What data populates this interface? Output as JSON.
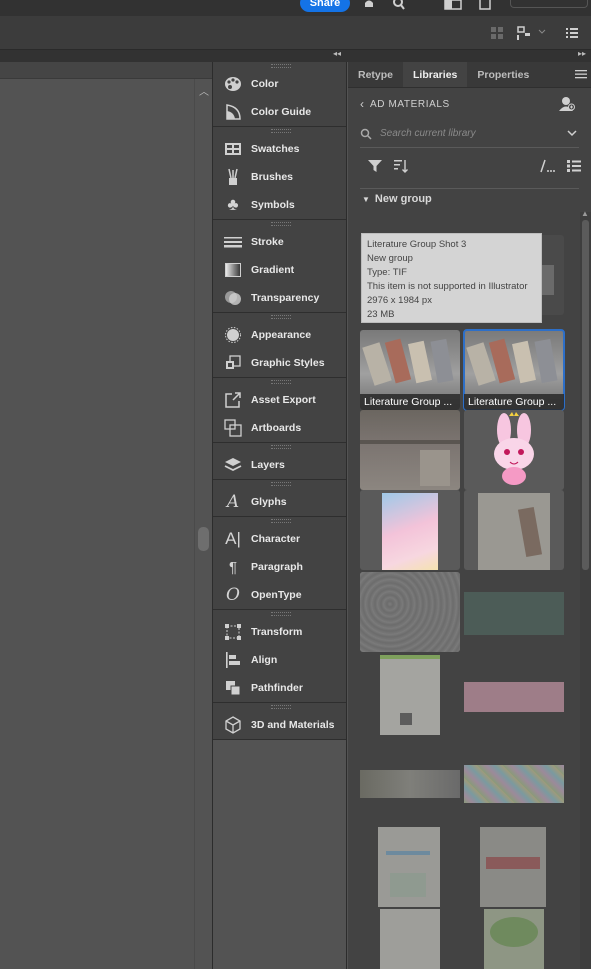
{
  "topbar": {
    "share_label": "Share"
  },
  "dock": {
    "groups": [
      {
        "items": [
          {
            "label": "Color",
            "icon": "color-palette-icon"
          },
          {
            "label": "Color Guide",
            "icon": "color-guide-icon"
          }
        ]
      },
      {
        "items": [
          {
            "label": "Swatches",
            "icon": "swatches-icon"
          },
          {
            "label": "Brushes",
            "icon": "brushes-icon"
          },
          {
            "label": "Symbols",
            "icon": "symbols-icon"
          }
        ]
      },
      {
        "items": [
          {
            "label": "Stroke",
            "icon": "stroke-icon"
          },
          {
            "label": "Gradient",
            "icon": "gradient-icon"
          },
          {
            "label": "Transparency",
            "icon": "transparency-icon"
          }
        ]
      },
      {
        "items": [
          {
            "label": "Appearance",
            "icon": "appearance-icon"
          },
          {
            "label": "Graphic Styles",
            "icon": "graphic-styles-icon"
          }
        ]
      },
      {
        "items": [
          {
            "label": "Asset Export",
            "icon": "asset-export-icon"
          },
          {
            "label": "Artboards",
            "icon": "artboards-icon"
          }
        ]
      },
      {
        "items": [
          {
            "label": "Layers",
            "icon": "layers-icon"
          }
        ]
      },
      {
        "items": [
          {
            "label": "Glyphs",
            "icon": "glyphs-icon"
          }
        ]
      },
      {
        "items": [
          {
            "label": "Character",
            "icon": "character-icon"
          },
          {
            "label": "Paragraph",
            "icon": "paragraph-icon"
          },
          {
            "label": "OpenType",
            "icon": "opentype-icon"
          }
        ]
      },
      {
        "items": [
          {
            "label": "Transform",
            "icon": "transform-icon"
          },
          {
            "label": "Align",
            "icon": "align-icon"
          },
          {
            "label": "Pathfinder",
            "icon": "pathfinder-icon"
          }
        ]
      },
      {
        "items": [
          {
            "label": "3D and Materials",
            "icon": "3d-materials-icon"
          }
        ]
      }
    ]
  },
  "libraries": {
    "tabs": [
      {
        "label": "Retype"
      },
      {
        "label": "Libraries"
      },
      {
        "label": "Properties"
      }
    ],
    "library_name": "AD MATERIALS",
    "search_placeholder": "Search current library",
    "group_name": "New group",
    "tooltip": {
      "name": "Literature Group Shot 3",
      "group": "New group",
      "type": "Type: TIF",
      "note": "This item is not supported in Illustrator",
      "dimensions": "2976 x 1984 px",
      "size": "23 MB"
    },
    "items": [
      {
        "caption": "Literature Group ..."
      },
      {
        "caption": "Literature Group ..."
      }
    ]
  },
  "colors": {
    "accent": "#1473e6",
    "selection": "#2d6fc8"
  }
}
